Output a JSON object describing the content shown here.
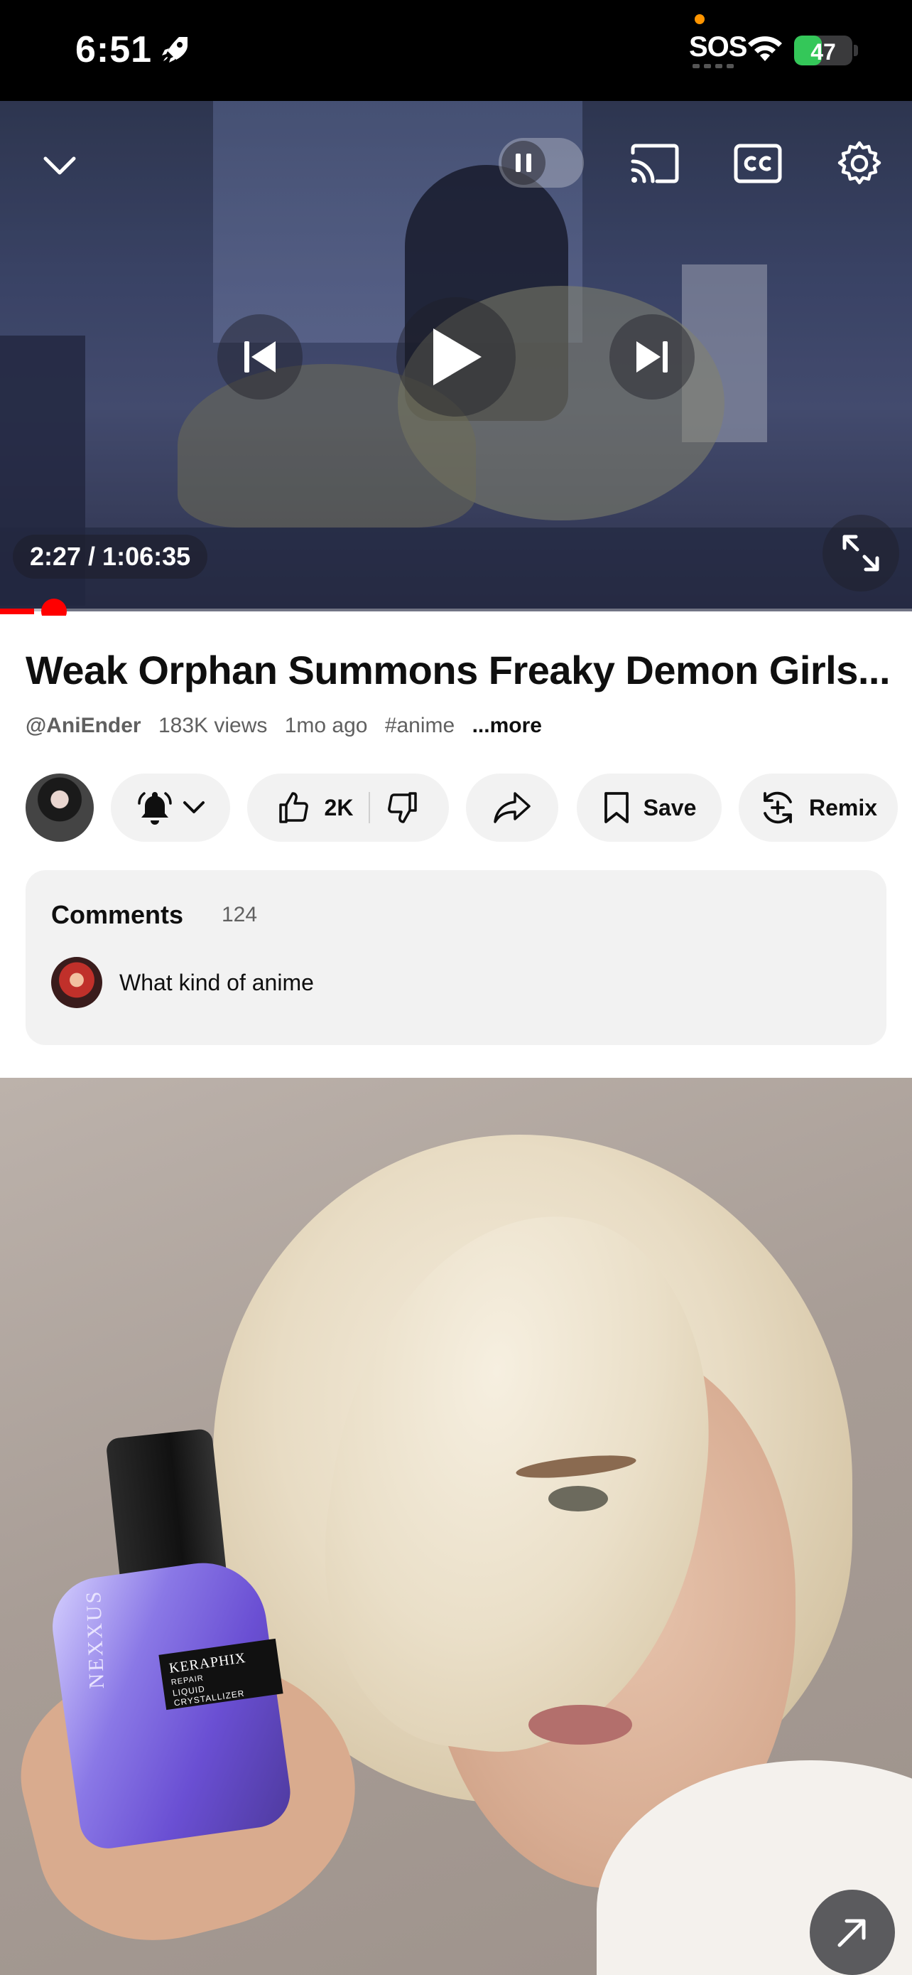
{
  "status_bar": {
    "time": "6:51",
    "sos": "SOS",
    "battery": "47",
    "battery_level": 0.47,
    "colors": {
      "battery": "#34c759",
      "dot": "#ff9500"
    },
    "icons": [
      "rocket-icon",
      "wifi-icon",
      "battery-icon"
    ]
  },
  "player": {
    "timecode": "2:27 / 1:06:35",
    "progress_fraction": 0.037,
    "buffer_fraction": 0.06,
    "icons": [
      "chevron-down-icon",
      "pause-icon",
      "cast-icon",
      "cc-icon",
      "gear-icon",
      "skip-previous-icon",
      "play-icon",
      "skip-next-icon",
      "fullscreen-icon"
    ],
    "colors": {
      "progress": "#ff0000"
    }
  },
  "video": {
    "title": "Weak Orphan Summons Freaky Demon Girls...",
    "channel_handle": "@AniEnder",
    "views": "183K views",
    "age": "1mo ago",
    "hashtag": "#anime",
    "more": "...more"
  },
  "actions": {
    "likes": "2K",
    "save_label": "Save",
    "remix_label": "Remix",
    "icons": [
      "bell-icon",
      "chevron-down-icon",
      "thumbs-up-icon",
      "thumbs-down-icon",
      "share-icon",
      "bookmark-icon",
      "remix-icon"
    ]
  },
  "comments": {
    "header": "Comments",
    "count": "124",
    "top_comment": "What kind of anime"
  },
  "ad": {
    "product_line1": "KERAPHIX",
    "product_line2": "REPAIR",
    "product_line3": "LIQUID CRYSTALLIZER",
    "brand": "NEXXUS",
    "icons": [
      "open-external-icon"
    ]
  }
}
